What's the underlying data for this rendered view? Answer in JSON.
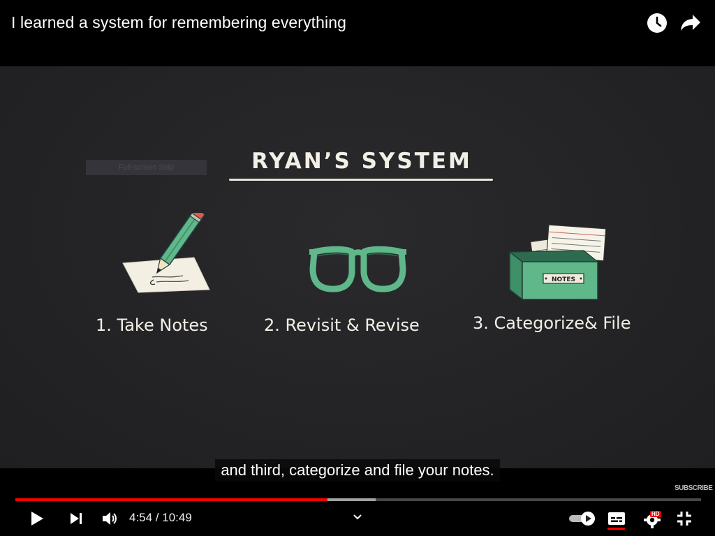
{
  "header": {
    "video_title": "I learned a system for remembering everything",
    "watch_later_icon": "clock-icon",
    "share_icon": "share-arrow-icon"
  },
  "slide": {
    "snip_overlay_text": "Full-screen Snip",
    "title": "RYAN’S SYSTEM",
    "steps": [
      {
        "label": "1. Take Notes",
        "icon": "pencil-paper-icon"
      },
      {
        "label": "2. Revisit & Revise",
        "icon": "glasses-icon"
      },
      {
        "label": "3. Categorize& File",
        "icon": "file-box-icon",
        "box_label": "NOTES"
      }
    ]
  },
  "caption": "and third, categorize and file your notes.",
  "watermark": "SUBSCRIBE",
  "player": {
    "progress_played_fraction": 0.455,
    "progress_buffered_fraction": 0.525,
    "time_display": "4:54 / 10:49",
    "hd_badge": "HD",
    "autoplay_on": true
  },
  "colors": {
    "accent_red": "#ff0000",
    "slide_green": "#5fb78a",
    "slide_background": "#252527"
  }
}
